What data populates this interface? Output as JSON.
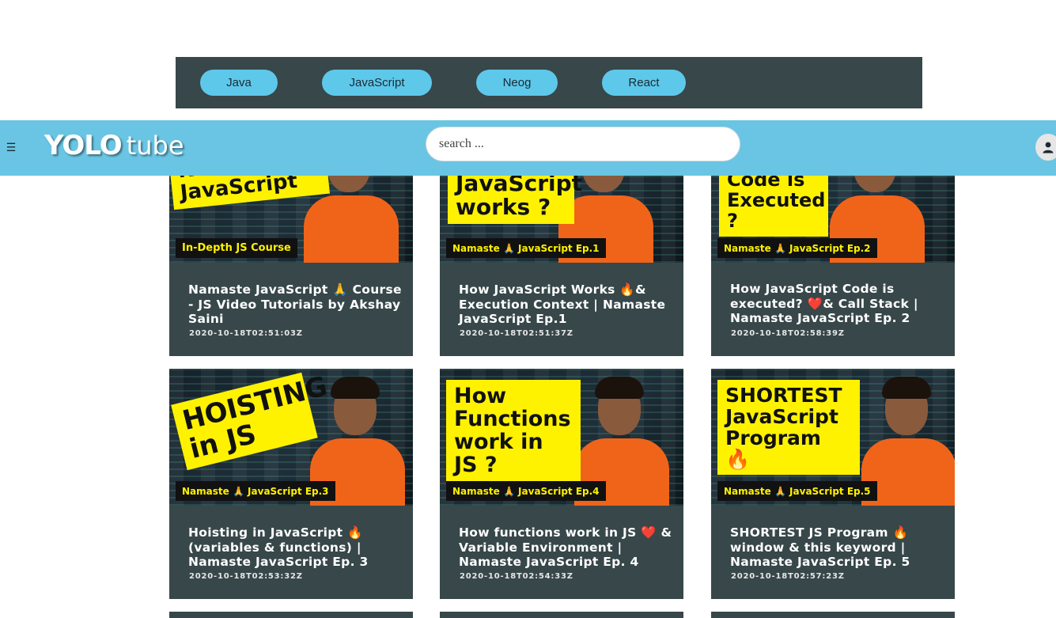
{
  "categories": [
    "Java",
    "JavaScript",
    "Neog",
    "React"
  ],
  "header": {
    "menu_icon": "menu-icon",
    "logo_part1": "YOLO",
    "logo_part2": "tube",
    "search_placeholder": "search ...",
    "avatar_icon": "user-icon"
  },
  "colors": {
    "header_bg": "#69c5e3",
    "chip_bg": "#5ec8ea",
    "catbar_bg": "#37474a",
    "card_bg": "#37474a",
    "thumb_headline": "#fff200",
    "shirt": "#f0641a"
  },
  "videos": [
    {
      "title": "Namaste JavaScript 🙏 Course - JS Video Tutorials by Akshay Saini",
      "date": "2020-10-18T02:51:03Z",
      "thumb_text": "Namaste JavaScript",
      "thumb_badge": "In-Depth JS Course"
    },
    {
      "title": "How JavaScript Works 🔥& Execution Context | Namaste JavaScript Ep.1",
      "date": "2020-10-18T02:51:37Z",
      "thumb_text": "JavaScript works ?",
      "thumb_badge": "Namaste 🙏 JavaScript Ep.1"
    },
    {
      "title": "How JavaScript Code is executed? ❤️& Call Stack | Namaste JavaScript Ep. 2",
      "date": "2020-10-18T02:58:39Z",
      "thumb_text": "Code is Executed ?",
      "thumb_badge": "Namaste 🙏 JavaScript Ep.2"
    },
    {
      "title": "Hoisting in JavaScript 🔥 (variables & functions) | Namaste JavaScript Ep. 3",
      "date": "2020-10-18T02:53:32Z",
      "thumb_text": "HOISTING in JS",
      "thumb_badge": "Namaste 🙏 JavaScript Ep.3"
    },
    {
      "title": "How functions work in JS ❤️ & Variable Environment | Namaste JavaScript Ep. 4",
      "date": "2020-10-18T02:54:33Z",
      "thumb_text": "How Functions work in JS ?",
      "thumb_badge": "Namaste 🙏 JavaScript Ep.4"
    },
    {
      "title": "SHORTEST JS Program 🔥 window & this keyword | Namaste JavaScript Ep. 5",
      "date": "2020-10-18T02:57:23Z",
      "thumb_text": "SHORTEST JavaScript Program 🔥",
      "thumb_badge": "Namaste 🙏 JavaScript Ep.5"
    }
  ]
}
